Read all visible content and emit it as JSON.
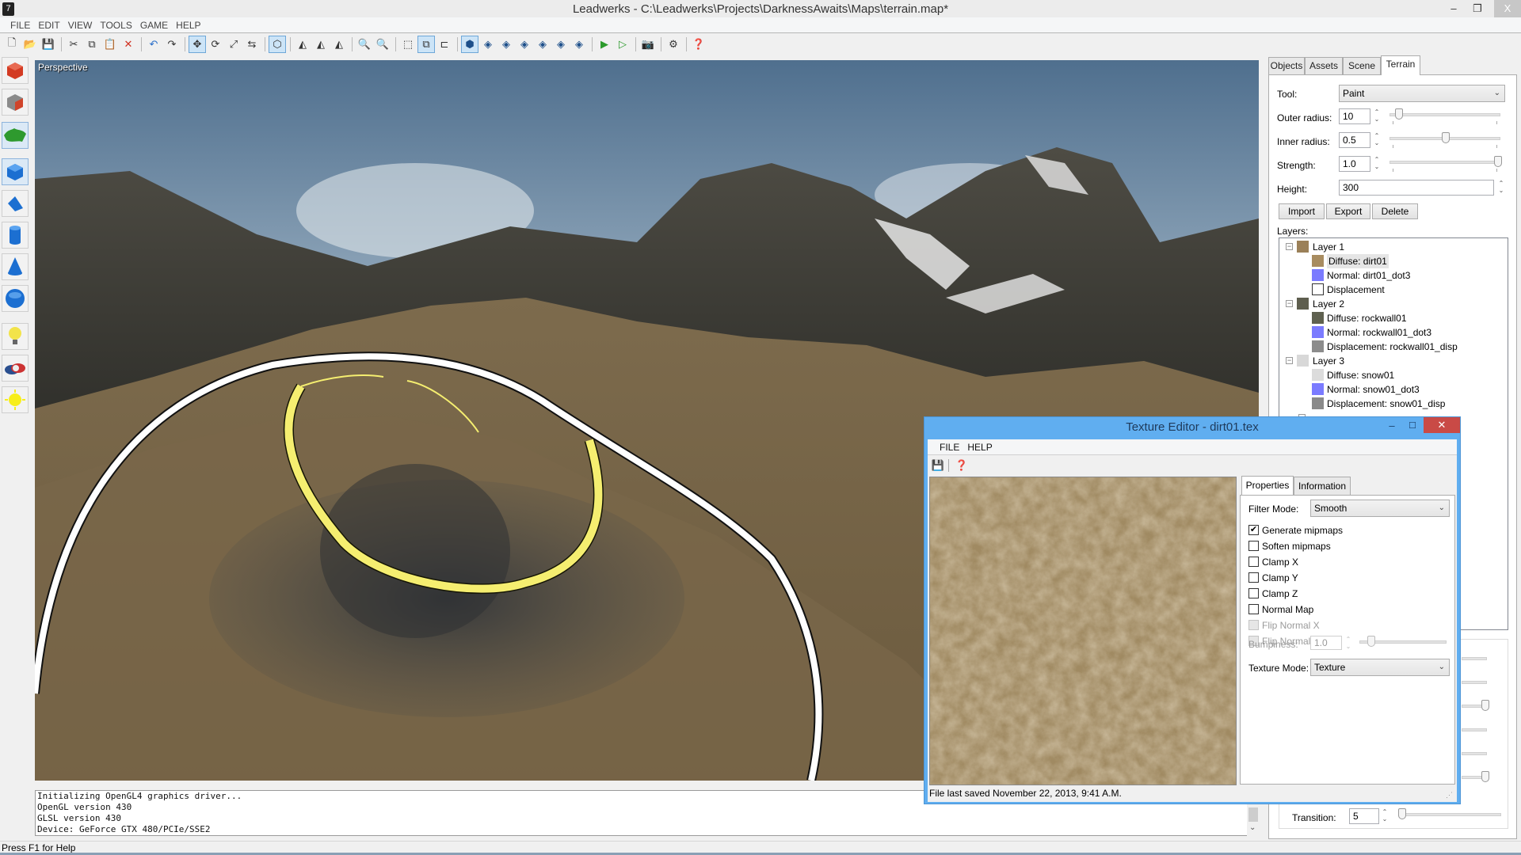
{
  "window": {
    "title": "Leadwerks - C:\\Leadwerks\\Projects\\DarknessAwaits\\Maps\\terrain.map*",
    "minimize": "–",
    "restore": "❐",
    "close": "X"
  },
  "menu": [
    "FILE",
    "EDIT",
    "VIEW",
    "TOOLS",
    "GAME",
    "HELP"
  ],
  "toolbar": {
    "groups": [
      [
        {
          "icon": "new-file-icon",
          "glyph": "🗋"
        },
        {
          "icon": "open-folder-icon",
          "glyph": "📂"
        },
        {
          "icon": "save-icon",
          "glyph": "💾"
        }
      ],
      [
        {
          "icon": "cut-icon",
          "glyph": "✂"
        },
        {
          "icon": "copy-icon",
          "glyph": "⧉"
        },
        {
          "icon": "paste-icon",
          "glyph": "📋"
        },
        {
          "icon": "delete-icon",
          "glyph": "✕",
          "color": "#d03020"
        }
      ],
      [
        {
          "icon": "undo-icon",
          "glyph": "↶",
          "color": "#2a6fc9"
        },
        {
          "icon": "redo-icon",
          "glyph": "↷"
        }
      ],
      [
        {
          "icon": "move-tool-icon",
          "glyph": "✥",
          "active": true
        },
        {
          "icon": "rotate-tool-icon",
          "glyph": "⟳"
        },
        {
          "icon": "scale-tool-icon",
          "glyph": "⤢"
        },
        {
          "icon": "swap-icon",
          "glyph": "⇆"
        }
      ],
      [
        {
          "icon": "snap-icon",
          "glyph": "⬡",
          "active": true
        }
      ],
      [
        {
          "icon": "align-left-icon",
          "glyph": "◭"
        },
        {
          "icon": "align-center-icon",
          "glyph": "◭"
        },
        {
          "icon": "align-right-icon",
          "glyph": "◭"
        }
      ],
      [
        {
          "icon": "zoom-in-icon",
          "glyph": "🔍"
        },
        {
          "icon": "zoom-out-icon",
          "glyph": "🔍"
        }
      ],
      [
        {
          "icon": "select-all-icon",
          "glyph": "⬚"
        },
        {
          "icon": "maximize-viewport-icon",
          "glyph": "⧉",
          "active": true
        },
        {
          "icon": "layout-icon",
          "glyph": "⊏"
        }
      ],
      [
        {
          "icon": "view-perspective-icon",
          "glyph": "⬢",
          "active": true,
          "color": "#1d4f8a"
        },
        {
          "icon": "view-top-icon",
          "glyph": "◈",
          "color": "#1d4f8a"
        },
        {
          "icon": "view-bottom-icon",
          "glyph": "◈",
          "color": "#1d4f8a"
        },
        {
          "icon": "view-front-icon",
          "glyph": "◈",
          "color": "#1d4f8a"
        },
        {
          "icon": "view-back-icon",
          "glyph": "◈",
          "color": "#1d4f8a"
        },
        {
          "icon": "view-left-icon",
          "glyph": "◈",
          "color": "#1d4f8a"
        },
        {
          "icon": "view-right-icon",
          "glyph": "◈",
          "color": "#1d4f8a"
        }
      ],
      [
        {
          "icon": "play-icon",
          "glyph": "▶",
          "color": "#2b9a2b"
        },
        {
          "icon": "play-outline-icon",
          "glyph": "▷",
          "color": "#2b9a2b"
        }
      ],
      [
        {
          "icon": "camera-icon",
          "glyph": "📷"
        }
      ],
      [
        {
          "icon": "settings-gear-icon",
          "glyph": "⚙"
        }
      ],
      [
        {
          "icon": "help-icon",
          "glyph": "❓"
        }
      ]
    ]
  },
  "palette": [
    {
      "icon": "red-box-brush-icon",
      "color": "#d33a22"
    },
    {
      "icon": "gray-box-icon",
      "color": "#8a8a8a"
    },
    {
      "icon": "terrain-icon",
      "color": "#2e9a2e",
      "active": true
    },
    {
      "icon": "box-primitive-icon",
      "color": "#1c6fd1",
      "active": true
    },
    {
      "icon": "wedge-primitive-icon",
      "color": "#1c6fd1"
    },
    {
      "icon": "cylinder-primitive-icon",
      "color": "#1c6fd1"
    },
    {
      "icon": "cone-primitive-icon",
      "color": "#1c6fd1"
    },
    {
      "icon": "sphere-primitive-icon",
      "color": "#1c6fd1"
    },
    {
      "icon": "point-light-icon",
      "color": "#f2e34a"
    },
    {
      "icon": "spot-light-icon",
      "color": "#c33"
    },
    {
      "icon": "directional-light-icon",
      "color": "#f7ee1a"
    }
  ],
  "viewport": {
    "label": "Perspective"
  },
  "console": {
    "lines": [
      "Initializing OpenGL4 graphics driver...",
      "OpenGL version 430",
      "GLSL version 430",
      "Device: GeForce GTX 480/PCIe/SSE2"
    ]
  },
  "status": {
    "text": "Press F1 for Help"
  },
  "right_panel": {
    "tabs": [
      {
        "label": "Objects",
        "active": false
      },
      {
        "label": "Assets",
        "active": false
      },
      {
        "label": "Scene",
        "active": false
      },
      {
        "label": "Terrain",
        "active": true
      }
    ],
    "tool": {
      "label": "Tool:",
      "value": "Paint"
    },
    "outer_radius": {
      "label": "Outer radius:",
      "value": "10",
      "slider": 0.05
    },
    "inner_radius": {
      "label": "Inner radius:",
      "value": "0.5",
      "slider": 0.5
    },
    "strength": {
      "label": "Strength:",
      "value": "1.0",
      "slider": 1.0
    },
    "height": {
      "label": "Height:",
      "value": "300"
    },
    "buttons": {
      "import": "Import",
      "export": "Export",
      "delete": "Delete"
    },
    "layers_label": "Layers:",
    "layers": [
      {
        "name": "Layer 1",
        "color": "#9b8058",
        "children": [
          {
            "label": "Diffuse: dirt01",
            "color": "#a88c60",
            "selected": true
          },
          {
            "label": "Normal: dirt01_dot3",
            "color": "#7b7bff"
          },
          {
            "label": "Displacement",
            "color": "#ffffff",
            "empty": true
          }
        ]
      },
      {
        "name": "Layer 2",
        "color": "#5e5e4e",
        "children": [
          {
            "label": "Diffuse: rockwall01",
            "color": "#5f6150"
          },
          {
            "label": "Normal: rockwall01_dot3",
            "color": "#7b7bff"
          },
          {
            "label": "Displacement: rockwall01_disp",
            "color": "#8c8c8c"
          }
        ]
      },
      {
        "name": "Layer 3",
        "color": "#d8d8d8",
        "children": [
          {
            "label": "Diffuse: snow01",
            "color": "#dcdcdc"
          },
          {
            "label": "Normal: snow01_dot3",
            "color": "#7b7bff"
          },
          {
            "label": "Displacement: snow01_disp",
            "color": "#8a8a8a"
          }
        ]
      }
    ],
    "transition": {
      "label": "Transition:",
      "value": "5",
      "slider": 0.0
    }
  },
  "texture_editor": {
    "title": "Texture Editor - dirt01.tex",
    "minimize": "–",
    "maximize": "☐",
    "close": "✕",
    "menu": [
      "FILE",
      "HELP"
    ],
    "tabs": [
      {
        "label": "Properties",
        "active": true
      },
      {
        "label": "Information",
        "active": false
      }
    ],
    "filter_mode": {
      "label": "Filter Mode:",
      "value": "Smooth"
    },
    "checkboxes": [
      {
        "label": "Generate mipmaps",
        "checked": true,
        "disabled": false
      },
      {
        "label": "Soften mipmaps",
        "checked": false,
        "disabled": false
      },
      {
        "label": "Clamp X",
        "checked": false,
        "disabled": false
      },
      {
        "label": "Clamp Y",
        "checked": false,
        "disabled": false
      },
      {
        "label": "Clamp Z",
        "checked": false,
        "disabled": false
      },
      {
        "label": "Normal Map",
        "checked": false,
        "disabled": false
      },
      {
        "label": "Flip Normal X",
        "checked": false,
        "disabled": true
      },
      {
        "label": "Flip Normal Y",
        "checked": false,
        "disabled": true
      }
    ],
    "bumpiness": {
      "label": "Bumpiness:",
      "value": "1.0",
      "slider": 0.1,
      "disabled": true
    },
    "texture_mode": {
      "label": "Texture Mode:",
      "value": "Texture"
    },
    "status": "File last saved November 22, 2013, 9:41 A.M."
  }
}
